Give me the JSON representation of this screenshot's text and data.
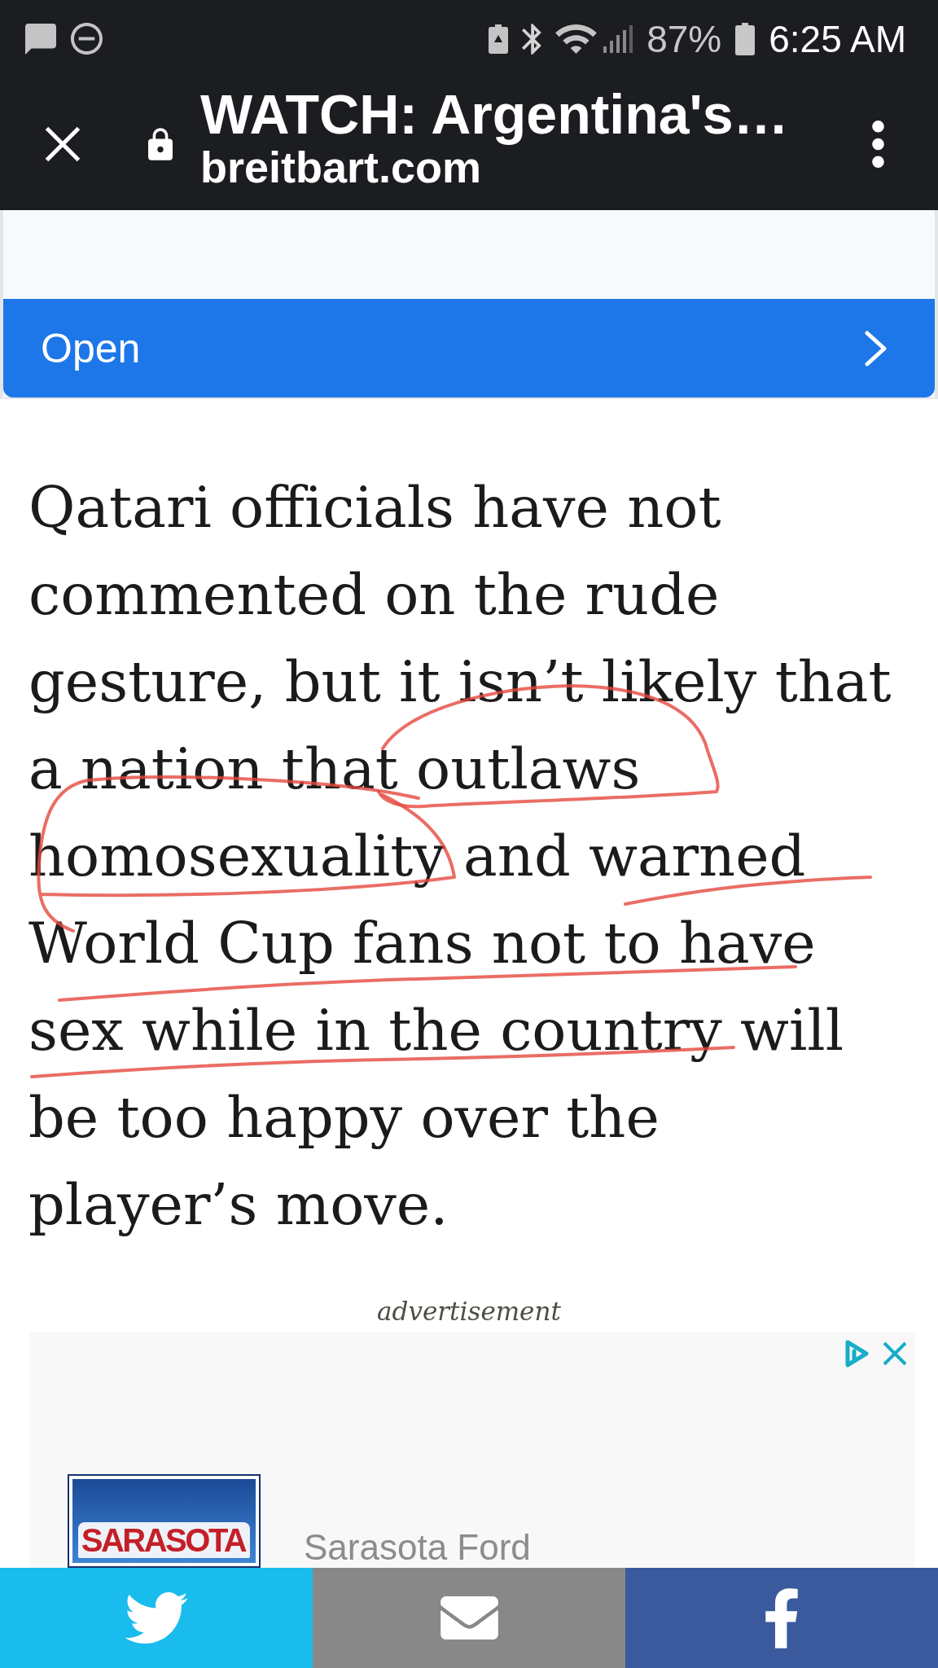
{
  "status_bar": {
    "battery": "87%",
    "time": "6:25 AM"
  },
  "toolbar": {
    "title": "WATCH: Argentina's…",
    "url": "breitbart.com"
  },
  "promo_card": {
    "button": "Open"
  },
  "article": {
    "paragraph": "Qatari officials have not commented on the rude gesture, but it isn’t likely that a nation that outlaws homosexuality and warned World Cup fans not to have sex while in the country will be too happy over the player’s move.",
    "pen_marks": true
  },
  "advertisement": {
    "label": "advertisement",
    "logo_text": "SARASOTA",
    "advertiser": "Sarasota Ford"
  },
  "share_bar": [
    {
      "kind": "twitter"
    },
    {
      "kind": "email"
    },
    {
      "kind": "facebook"
    }
  ]
}
